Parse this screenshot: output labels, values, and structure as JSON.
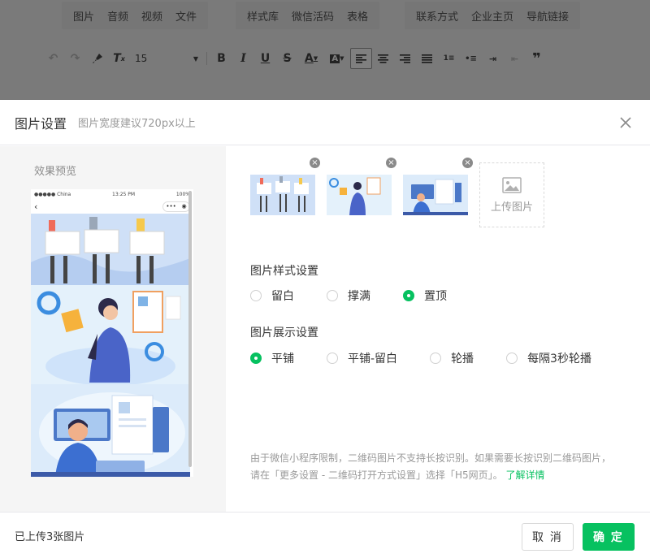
{
  "editor": {
    "menu_groups": [
      [
        "图片",
        "音频",
        "视频",
        "文件"
      ],
      [
        "样式库",
        "微信活码",
        "表格"
      ],
      [
        "联系方式",
        "企业主页",
        "导航链接"
      ]
    ],
    "font_size": "15"
  },
  "dialog": {
    "title": "图片设置",
    "subtitle": "图片宽度建议720px以上",
    "preview_label": "效果预览",
    "phone": {
      "carrier": "●●●●● China",
      "time": "13:25 PM",
      "battery": "100%"
    },
    "upload_label": "上传图片",
    "style_section": {
      "title": "图片样式设置",
      "options": [
        "留白",
        "撑满",
        "置顶"
      ],
      "selected": "置顶"
    },
    "display_section": {
      "title": "图片展示设置",
      "options": [
        "平铺",
        "平铺-留白",
        "轮播",
        "每隔3秒轮播"
      ],
      "selected": "平铺"
    },
    "note_line1": "由于微信小程序限制，二维码图片不支持长按识别。如果需要长按识别二维码图片，",
    "note_line2": "请在「更多设置 - 二维码打开方式设置」选择「H5网页」。",
    "note_link": "了解详情",
    "footer_status": "已上传3张图片",
    "cancel_label": "取 消",
    "ok_label": "确 定"
  },
  "colors": {
    "accent": "#07c160",
    "illustration_blue": "#cfe3fa",
    "illustration_dark": "#3b5aa8"
  }
}
